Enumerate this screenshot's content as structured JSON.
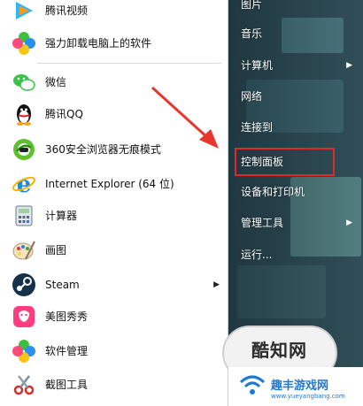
{
  "left_menu": {
    "items": [
      {
        "label": "腾讯视频",
        "icon": "tencent-video-icon"
      },
      {
        "label": "强力卸载电脑上的软件",
        "icon": "uninstall-pinwheel-icon"
      },
      {
        "label": "微信",
        "icon": "wechat-icon"
      },
      {
        "label": "腾讯QQ",
        "icon": "qq-penguin-icon"
      },
      {
        "label": "360安全浏览器无痕模式",
        "icon": "360-browser-icon"
      },
      {
        "label": "Internet Explorer (64 位)",
        "icon": "internet-explorer-icon"
      },
      {
        "label": "计算器",
        "icon": "calculator-icon"
      },
      {
        "label": "画图",
        "icon": "paint-icon"
      },
      {
        "label": "Steam",
        "icon": "steam-icon"
      },
      {
        "label": "美图秀秀",
        "icon": "meitu-icon"
      },
      {
        "label": "软件管理",
        "icon": "software-manager-icon"
      },
      {
        "label": "截图工具",
        "icon": "snipping-tool-icon"
      }
    ]
  },
  "right_menu": {
    "items": [
      {
        "label": "图片"
      },
      {
        "label": "音乐"
      },
      {
        "label": "计算机"
      },
      {
        "label": "网络"
      },
      {
        "label": "连接到"
      },
      {
        "label": "控制面板"
      },
      {
        "label": "设备和打印机"
      },
      {
        "label": "管理工具"
      },
      {
        "label": "运行..."
      }
    ]
  },
  "watermark": {
    "logo_text": "酷知网",
    "site_name": "趣丰游戏网",
    "site_url": "www.yueyangbang.com"
  },
  "colors": {
    "highlight": "#e02a2a",
    "arrow": "#e8362f",
    "right_pane": "#2d4a54",
    "watermark_blue": "#1f78d1"
  }
}
